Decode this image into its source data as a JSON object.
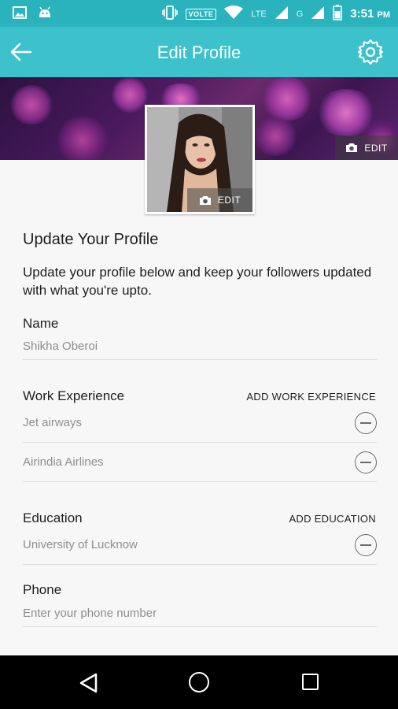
{
  "status_bar": {
    "network_label": "VOLTE",
    "lte_label": "LTE",
    "g_label": "G",
    "time": "3:51",
    "ampm": "PM"
  },
  "app_bar": {
    "title": "Edit Profile",
    "back_icon": "arrow-left-icon",
    "settings_icon": "gear-icon"
  },
  "cover": {
    "edit_label": "EDIT"
  },
  "avatar": {
    "edit_label": "EDIT"
  },
  "profile": {
    "heading": "Update Your Profile",
    "description": "Update your profile below and keep your followers updated with what you're upto."
  },
  "name_section": {
    "label": "Name",
    "value": "Shikha Oberoi"
  },
  "work_section": {
    "label": "Work Experience",
    "action": "ADD WORK EXPERIENCE",
    "items": [
      "Jet airways",
      "Airindia Airlines"
    ]
  },
  "education_section": {
    "label": "Education",
    "action": "ADD EDUCATION",
    "items": [
      "University of Lucknow"
    ]
  },
  "phone_section": {
    "label": "Phone",
    "placeholder": "Enter your phone number"
  },
  "colors": {
    "status_bar": "#2ab3bd",
    "app_bar": "#3dc2cc",
    "nav_bar": "#000000"
  }
}
